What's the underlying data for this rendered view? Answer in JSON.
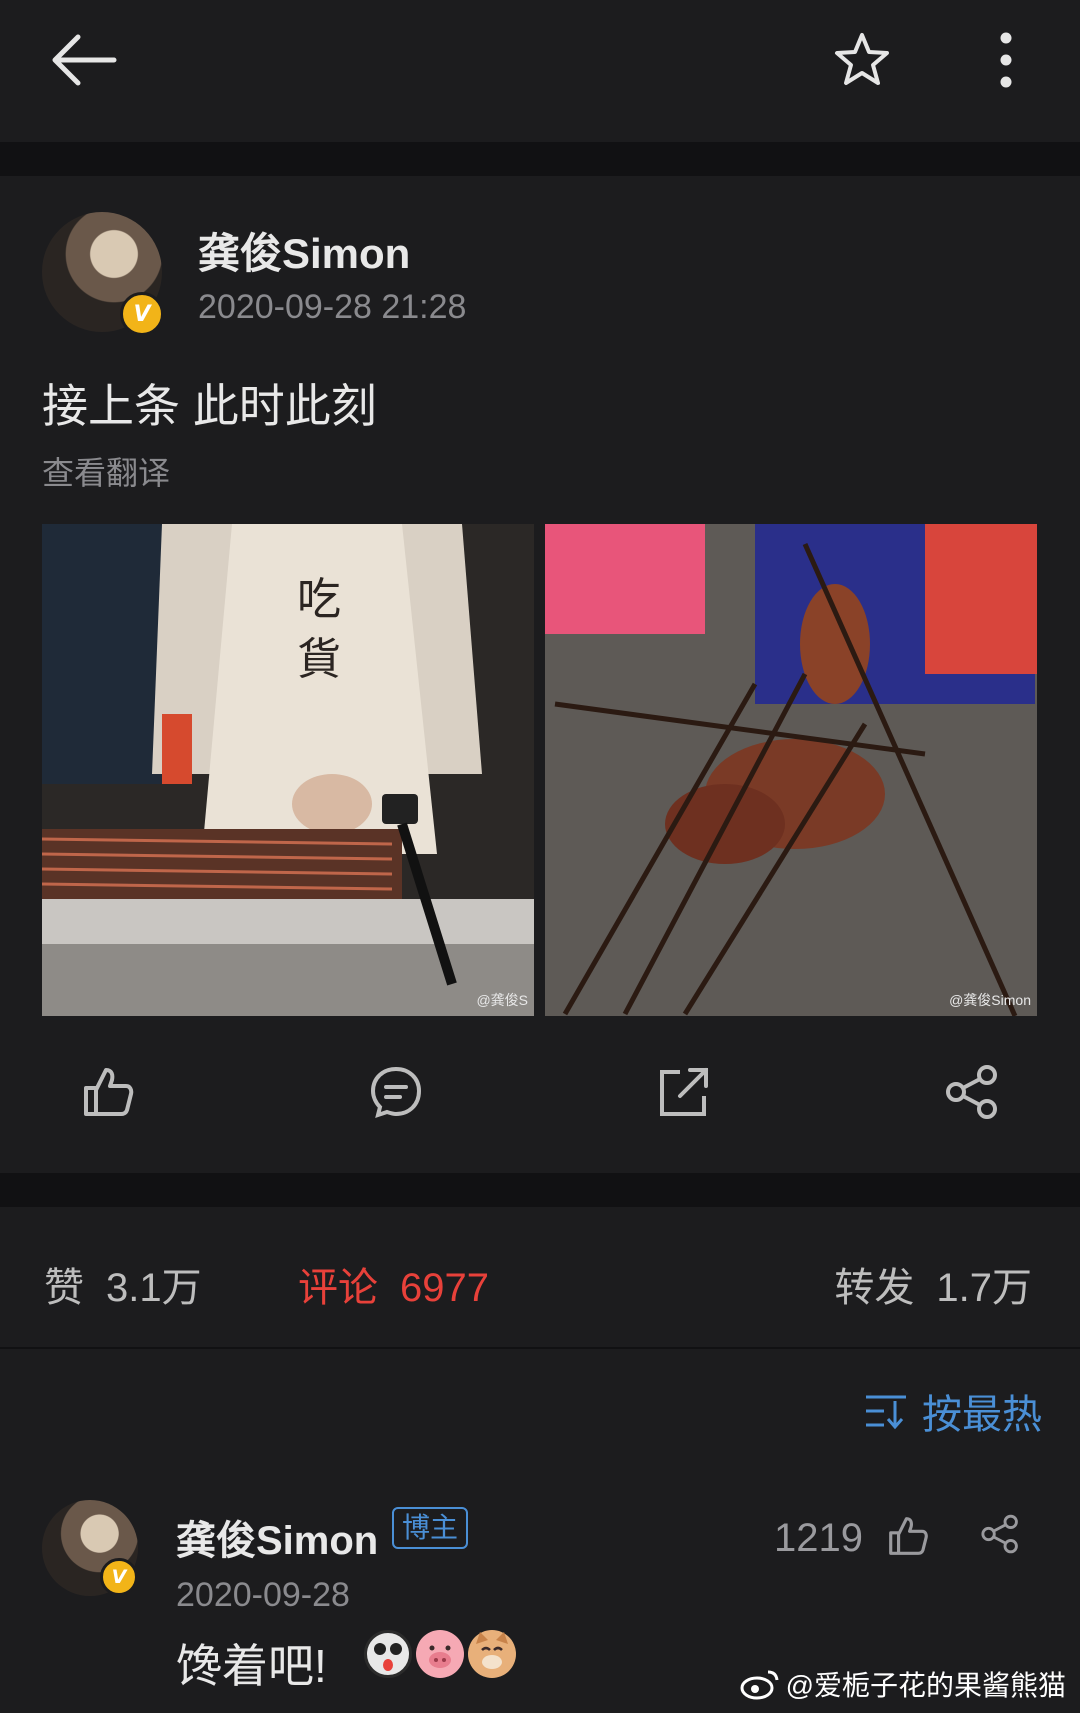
{
  "header": {
    "back_icon": "arrow-left-icon",
    "favorite_icon": "star-icon",
    "more_icon": "more-vertical-icon"
  },
  "post": {
    "author": "龚俊Simon",
    "verified_badge": "V",
    "time": "2020-09-28 21:28",
    "text": "接上条 此时此刻",
    "translate_label": "查看翻译",
    "photos": [
      {
        "description": "apron-grill-photo",
        "watermark": "@龚俊S"
      },
      {
        "description": "skewers-photo",
        "watermark": "@龚俊Simon"
      }
    ],
    "actions": {
      "like_icon": "thumbs-up-icon",
      "comment_icon": "comment-icon",
      "repost_icon": "repost-icon",
      "share_icon": "share-icon"
    }
  },
  "stats": {
    "likes_label": "赞",
    "likes_value": "3.1万",
    "comments_label": "评论",
    "comments_value": "6977",
    "reposts_label": "转发",
    "reposts_value": "1.7万",
    "active_color": "#e8413a"
  },
  "sort": {
    "label": "按最热",
    "icon": "sort-icon",
    "color": "#4a8fd6"
  },
  "comment": {
    "author": "龚俊Simon",
    "badge": "博主",
    "time": "2020-09-28",
    "likes": "1219",
    "text": "馋着吧!",
    "emojis": [
      "panda-tongue-emoji",
      "pig-emoji",
      "cat-emoji"
    ]
  },
  "watermark": {
    "text": "@爱栀子花的果酱熊猫",
    "icon": "weibo-logo-icon"
  }
}
